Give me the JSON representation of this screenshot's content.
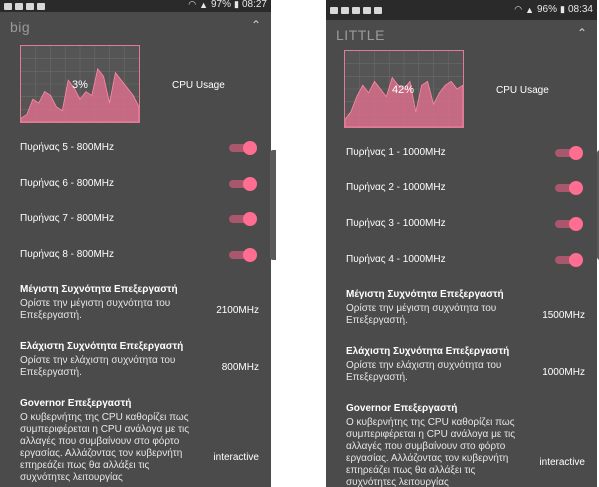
{
  "left": {
    "status": {
      "battery_pct": "97%",
      "time": "08:27"
    },
    "section_title": "big",
    "graph": {
      "percent_label": "3%",
      "label": "CPU Usage",
      "usage_series": [
        0.05,
        0.1,
        0.3,
        0.25,
        0.4,
        0.35,
        0.2,
        0.15,
        0.55,
        0.45,
        0.3,
        0.4,
        0.35,
        0.7,
        0.6,
        0.25,
        0.65,
        0.55,
        0.45,
        0.35,
        0.2
      ]
    },
    "cores": [
      {
        "label": "Πυρήνας 5 - 800MHz",
        "on": true
      },
      {
        "label": "Πυρήνας 6 - 800MHz",
        "on": true
      },
      {
        "label": "Πυρήνας 7 - 800MHz",
        "on": true
      },
      {
        "label": "Πυρήνας 8 - 800MHz",
        "on": true
      }
    ],
    "max_freq": {
      "title": "Μέγιστη Συχνότητα Επεξεργαστή",
      "desc": "Ορίστε την μέγιστη συχνότητα του Επεξεργαστή.",
      "value": "2100MHz"
    },
    "min_freq": {
      "title": "Ελάχιστη Συχνότητα Επεξεργαστή",
      "desc": "Ορίστε την ελάχιστη συχνότητα του Επεξεργαστή.",
      "value": "800MHz"
    },
    "governor": {
      "title": "Governor Επεξεργαστή",
      "desc": "Ο κυβερνήτης της CPU καθορίζει πως συμπεριφέρεται η CPU ανάλογα με τις αλλαγές που συμβαίνουν στο φόρτο εργασίας. Αλλάζοντας τον κυβερνήτη επηρεάζει πως θα αλλάξει τις συχνότητες λειτουργίας",
      "value": "interactive"
    }
  },
  "right": {
    "status": {
      "battery_pct": "96%",
      "time": "08:34"
    },
    "section_title": "LITTLE",
    "graph": {
      "percent_label": "42%",
      "label": "CPU Usage",
      "usage_series": [
        0.1,
        0.2,
        0.4,
        0.55,
        0.45,
        0.6,
        0.5,
        0.4,
        0.65,
        0.55,
        0.5,
        0.6,
        0.2,
        0.55,
        0.6,
        0.3,
        0.45,
        0.55,
        0.6,
        0.5,
        0.55
      ]
    },
    "cores": [
      {
        "label": "Πυρήνας 1 - 1000MHz",
        "on": true
      },
      {
        "label": "Πυρήνας 2 - 1000MHz",
        "on": true
      },
      {
        "label": "Πυρήνας 3 - 1000MHz",
        "on": true
      },
      {
        "label": "Πυρήνας 4 - 1000MHz",
        "on": true
      }
    ],
    "max_freq": {
      "title": "Μέγιστη Συχνότητα Επεξεργαστή",
      "desc": "Ορίστε την μέγιστη συχνότητα του Επεξεργαστή.",
      "value": "1500MHz"
    },
    "min_freq": {
      "title": "Ελάχιστη Συχνότητα Επεξεργαστή",
      "desc": "Ορίστε την ελάχιστη συχνότητα του Επεξεργαστή.",
      "value": "1000MHz"
    },
    "governor": {
      "title": "Governor Επεξεργαστή",
      "desc": "Ο κυβερνήτης της CPU καθορίζει πως συμπεριφέρεται η CPU ανάλογα με τις αλλαγές που συμβαίνουν στο φόρτο εργασίας. Αλλάζοντας τον κυβερνήτη επηρεάζει πως θα αλλάξει τις συχνότητες λειτουργίας",
      "value": "interactive"
    }
  },
  "colors": {
    "accent": "#ff6e91",
    "panel": "#4b4b4b",
    "graph_fill": "#d96f8c"
  }
}
